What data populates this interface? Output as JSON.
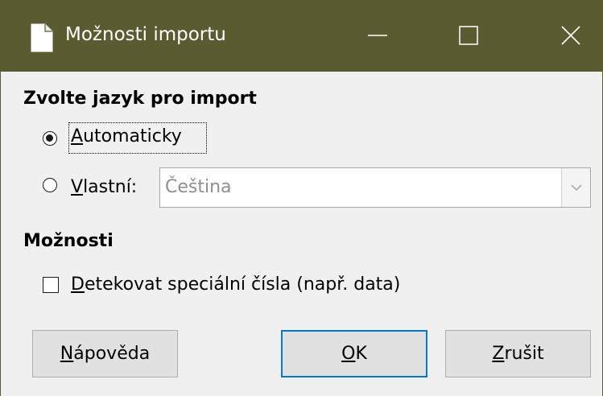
{
  "window": {
    "title": "Možnosti importu",
    "icons": {
      "app": "document-icon",
      "minimize": "minimize-icon",
      "maximize": "maximize-icon",
      "close": "close-icon"
    },
    "titlebar_color": "#5b5b32"
  },
  "language_section": {
    "heading": "Zvolte jazyk pro import",
    "automatic": {
      "mnemonic": "A",
      "rest": "utomaticky",
      "selected": true
    },
    "custom": {
      "mnemonic": "V",
      "rest": "lastní:",
      "selected": false
    },
    "language_select": {
      "value": "Čeština",
      "enabled": false,
      "icon": "chevron-down-icon"
    }
  },
  "options_section": {
    "heading": "Možnosti",
    "detect_special_numbers": {
      "mnemonic": "D",
      "rest": "etekovat speciální čísla (např. data)",
      "checked": false
    }
  },
  "buttons": {
    "help": {
      "mnemonic": "N",
      "rest": "ápověda"
    },
    "ok": {
      "mnemonic": "O",
      "rest": "K",
      "default": true
    },
    "cancel": {
      "mnemonic": "Z",
      "rest": "rušit"
    }
  },
  "colors": {
    "dialog_background": "#f0f0f0",
    "default_button_border": "#0078d7",
    "disabled_text": "#8f8f8f"
  }
}
